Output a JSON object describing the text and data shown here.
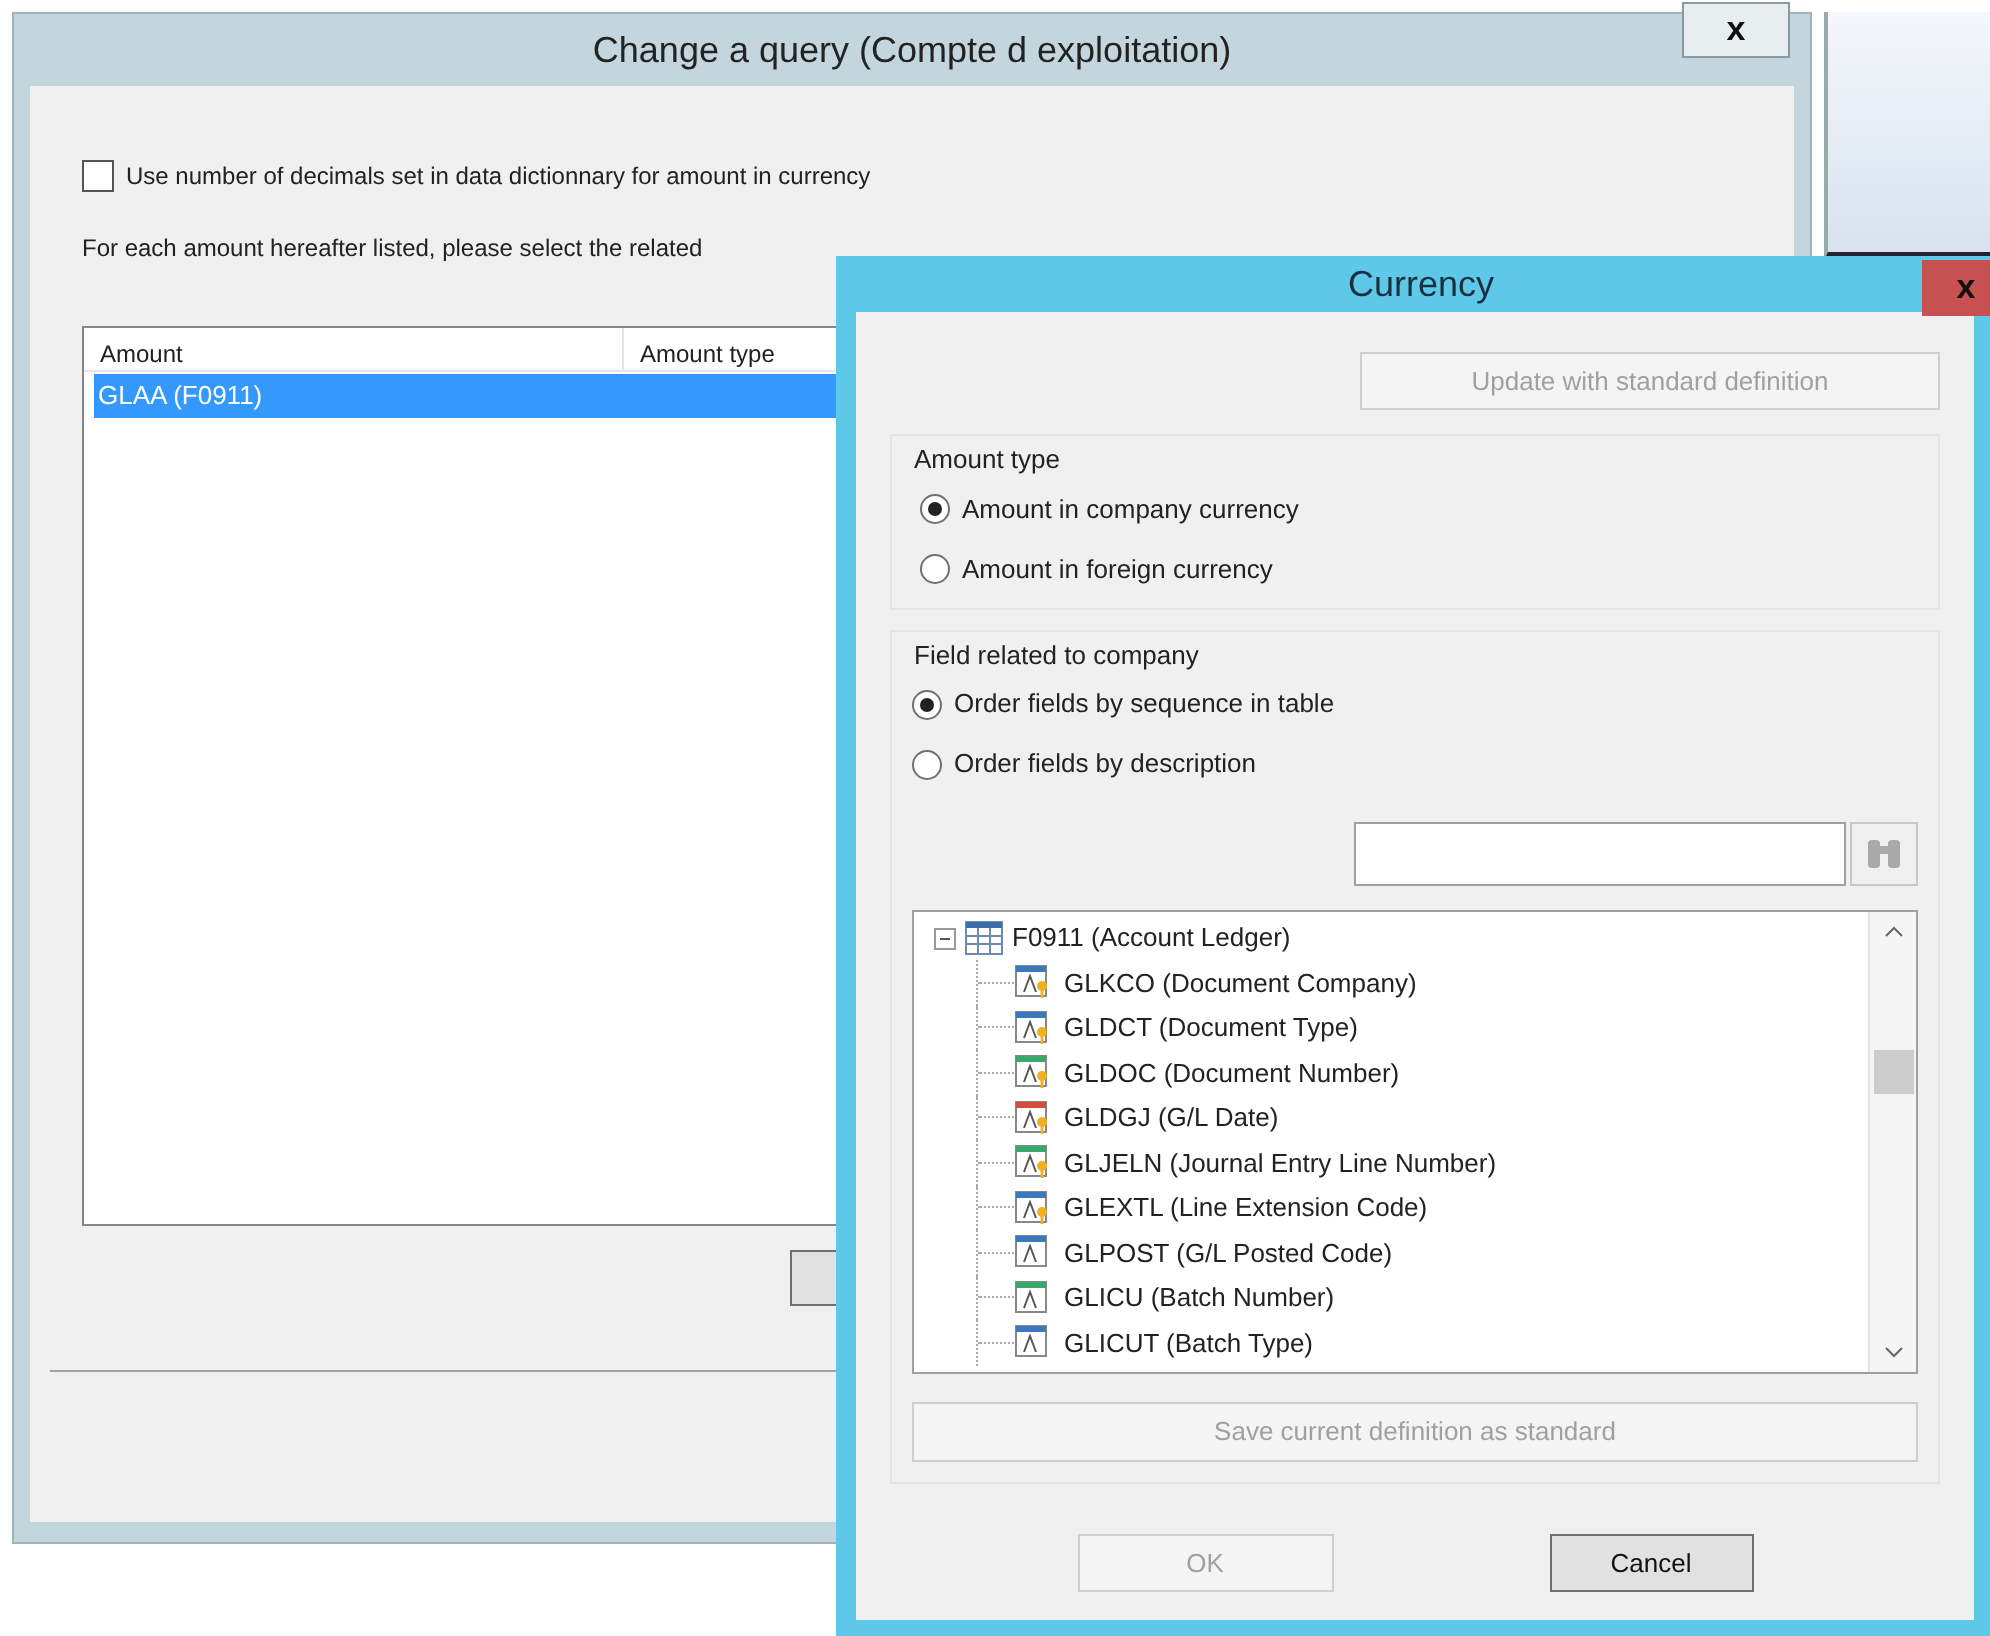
{
  "main_window": {
    "title": "Change a query (Compte d exploitation)",
    "close": "x",
    "use_decimals": {
      "label": "Use number of decimals set in data dictionnary for amount in currency",
      "checked": false
    },
    "instruction": "For each amount hereafter listed, please select the related",
    "table": {
      "columns": [
        "Amount",
        "Amount type"
      ],
      "rows": [
        {
          "amount": "GLAA (F0911)",
          "selected": true
        }
      ]
    }
  },
  "currency_dialog": {
    "title": "Currency",
    "close": "x",
    "update_button": {
      "label": "Update with standard definition",
      "disabled": true
    },
    "amount_type": {
      "legend": "Amount type",
      "options": [
        {
          "label": "Amount in company currency",
          "selected": true
        },
        {
          "label": "Amount in foreign currency",
          "selected": false
        }
      ]
    },
    "field_related": {
      "legend": "Field related to company",
      "options": [
        {
          "label": "Order fields by sequence in table",
          "selected": true
        },
        {
          "label": "Order fields by description",
          "selected": false
        }
      ]
    },
    "tree": {
      "label": "F0911 (Account Ledger)",
      "expanded": true,
      "children": [
        {
          "label": "GLKCO (Document Company)",
          "kind": "string",
          "key": true
        },
        {
          "label": "GLDCT (Document Type)",
          "kind": "string",
          "key": true
        },
        {
          "label": "GLDOC (Document Number)",
          "kind": "number",
          "key": true
        },
        {
          "label": "GLDGJ (G/L Date)",
          "kind": "date",
          "key": true
        },
        {
          "label": "GLJELN (Journal Entry Line Number)",
          "kind": "number",
          "key": true
        },
        {
          "label": "GLEXTL (Line Extension Code)",
          "kind": "string",
          "key": true
        },
        {
          "label": "GLPOST (G/L Posted Code)",
          "kind": "string",
          "key": false
        },
        {
          "label": "GLICU (Batch Number)",
          "kind": "number",
          "key": false
        },
        {
          "label": "GLICUT (Batch Type)",
          "kind": "string",
          "key": false
        }
      ]
    },
    "save_button": {
      "label": "Save current definition as standard",
      "disabled": true
    },
    "ok_button": {
      "label": "OK",
      "disabled": true
    },
    "cancel_button": {
      "label": "Cancel",
      "disabled": false
    }
  }
}
